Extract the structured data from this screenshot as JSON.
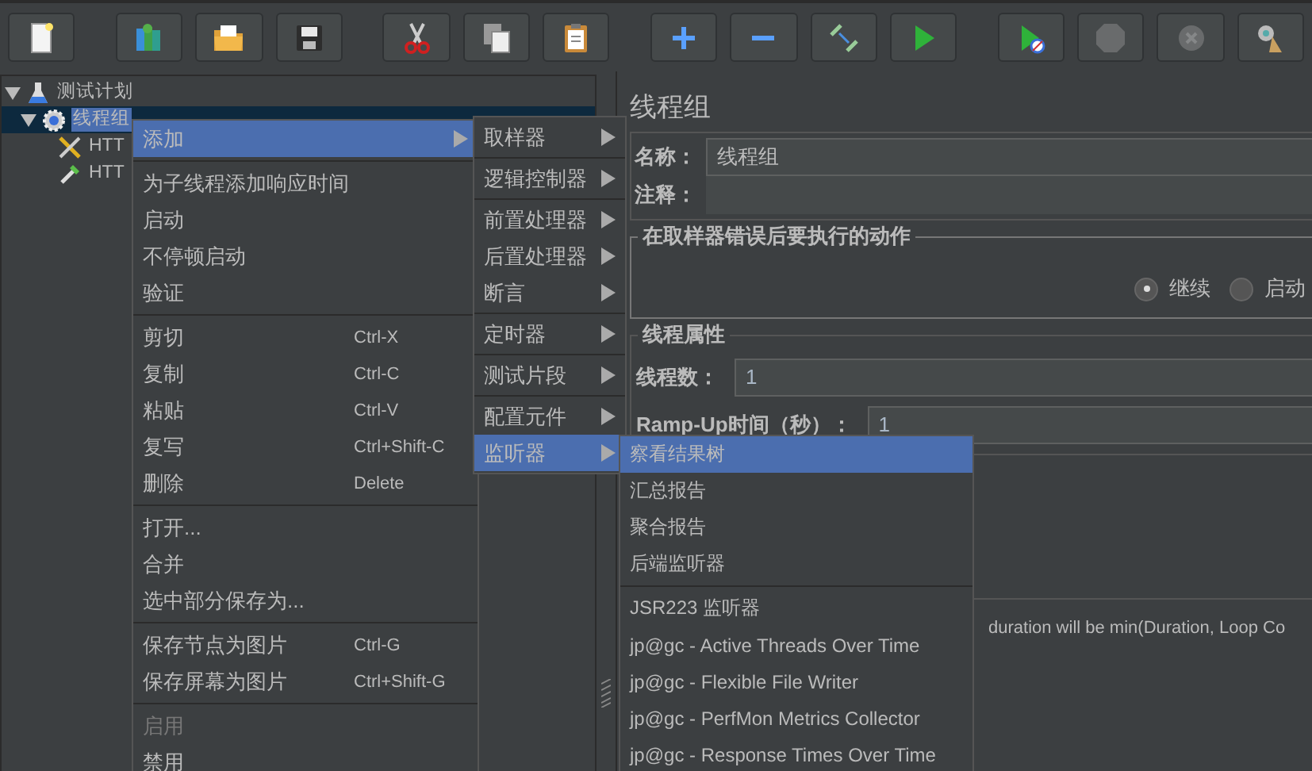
{
  "toolbar": [
    {
      "kind": "new",
      "disabled": false
    },
    {
      "kind": "templates",
      "disabled": false
    },
    {
      "kind": "open",
      "disabled": false
    },
    {
      "kind": "save",
      "disabled": false
    },
    {
      "kind": "cut",
      "disabled": false
    },
    {
      "kind": "copy",
      "disabled": false
    },
    {
      "kind": "paste",
      "disabled": false
    },
    {
      "kind": "expand",
      "disabled": false
    },
    {
      "kind": "collapse",
      "disabled": false
    },
    {
      "kind": "toggle",
      "disabled": false
    },
    {
      "kind": "start",
      "disabled": false
    },
    {
      "kind": "start-no-pause",
      "disabled": false
    },
    {
      "kind": "stop",
      "disabled": true
    },
    {
      "kind": "shutdown",
      "disabled": true
    },
    {
      "kind": "clear",
      "disabled": false
    }
  ],
  "tree": [
    {
      "label": "测试计划",
      "kind": "plan",
      "expanded": true,
      "selected": false,
      "children": [
        {
          "label": "线程组",
          "kind": "thread-group",
          "expanded": true,
          "selected": true,
          "children": [
            {
              "label": "HTT",
              "kind": "config",
              "selected": false
            },
            {
              "label": "HTT",
              "kind": "sampler",
              "selected": false
            }
          ]
        }
      ]
    }
  ],
  "menus": [
    {
      "groups": [
        [
          {
            "label": "添加",
            "submenu": true,
            "selected": true,
            "disabled": false
          }
        ],
        [
          {
            "label": "为子线程添加响应时间",
            "submenu": false,
            "selected": false,
            "disabled": false
          },
          {
            "label": "启动",
            "submenu": false,
            "selected": false,
            "disabled": false
          },
          {
            "label": "不停顿启动",
            "submenu": false,
            "selected": false,
            "disabled": false
          },
          {
            "label": "验证",
            "submenu": false,
            "selected": false,
            "disabled": false
          }
        ],
        [
          {
            "label": "剪切",
            "shortcut": "Ctrl-X",
            "submenu": false,
            "selected": false,
            "disabled": false
          },
          {
            "label": "复制",
            "shortcut": "Ctrl-C",
            "submenu": false,
            "selected": false,
            "disabled": false
          },
          {
            "label": "粘贴",
            "shortcut": "Ctrl-V",
            "submenu": false,
            "selected": false,
            "disabled": false
          },
          {
            "label": "复写",
            "shortcut": "Ctrl+Shift-C",
            "submenu": false,
            "selected": false,
            "disabled": false
          },
          {
            "label": "删除",
            "shortcut": "Delete",
            "submenu": false,
            "selected": false,
            "disabled": false
          }
        ],
        [
          {
            "label": "打开...",
            "submenu": false,
            "selected": false,
            "disabled": false
          },
          {
            "label": "合并",
            "submenu": false,
            "selected": false,
            "disabled": false
          },
          {
            "label": "选中部分保存为...",
            "submenu": false,
            "selected": false,
            "disabled": false
          }
        ],
        [
          {
            "label": "保存节点为图片",
            "shortcut": "Ctrl-G",
            "submenu": false,
            "selected": false,
            "disabled": false
          },
          {
            "label": "保存屏幕为图片",
            "shortcut": "Ctrl+Shift-G",
            "submenu": false,
            "selected": false,
            "disabled": false
          }
        ],
        [
          {
            "label": "启用",
            "submenu": false,
            "selected": false,
            "disabled": true
          },
          {
            "label": "禁用",
            "submenu": false,
            "selected": false,
            "disabled": false
          }
        ]
      ]
    },
    {
      "groups": [
        [
          {
            "label": "取样器",
            "submenu": true,
            "selected": false,
            "disabled": false
          }
        ],
        [
          {
            "label": "逻辑控制器",
            "submenu": true,
            "selected": false,
            "disabled": false
          }
        ],
        [
          {
            "label": "前置处理器",
            "submenu": true,
            "selected": false,
            "disabled": false
          },
          {
            "label": "后置处理器",
            "submenu": true,
            "selected": false,
            "disabled": false
          },
          {
            "label": "断言",
            "submenu": true,
            "selected": false,
            "disabled": false
          }
        ],
        [
          {
            "label": "定时器",
            "submenu": true,
            "selected": false,
            "disabled": false
          }
        ],
        [
          {
            "label": "测试片段",
            "submenu": true,
            "selected": false,
            "disabled": false
          }
        ],
        [
          {
            "label": "配置元件",
            "submenu": true,
            "selected": false,
            "disabled": false
          },
          {
            "label": "监听器",
            "submenu": true,
            "selected": true,
            "disabled": false
          }
        ]
      ]
    },
    {
      "groups": [
        [
          {
            "label": "察看结果树",
            "submenu": false,
            "selected": true,
            "disabled": false
          },
          {
            "label": "汇总报告",
            "submenu": false,
            "selected": false,
            "disabled": false
          },
          {
            "label": "聚合报告",
            "submenu": false,
            "selected": false,
            "disabled": false
          },
          {
            "label": "后端监听器",
            "submenu": false,
            "selected": false,
            "disabled": false
          }
        ],
        [
          {
            "label": "JSR223 监听器",
            "submenu": false,
            "selected": false,
            "disabled": false
          },
          {
            "label": "jp@gc - Active Threads Over Time",
            "submenu": false,
            "selected": false,
            "disabled": false
          },
          {
            "label": "jp@gc - Flexible File Writer",
            "submenu": false,
            "selected": false,
            "disabled": false
          },
          {
            "label": "jp@gc - PerfMon Metrics Collector",
            "submenu": false,
            "selected": false,
            "disabled": false
          },
          {
            "label": "jp@gc - Response Times Over Time",
            "submenu": false,
            "selected": false,
            "disabled": false
          }
        ]
      ]
    }
  ],
  "editor": {
    "title": "线程组",
    "name_label": "名称：",
    "name_value": "线程组",
    "comment_label": "注释：",
    "on_error": {
      "legend": "在取样器错误后要执行的动作",
      "options": [
        {
          "label": "继续",
          "selected": true
        },
        {
          "label": "启动",
          "selected": false
        }
      ]
    },
    "thread_props": {
      "legend": "线程属性",
      "fields": [
        {
          "label": "线程数：",
          "value": "1"
        },
        {
          "label": "Ramp-Up时间（秒）：",
          "value": "1"
        }
      ]
    },
    "note": "duration will be min(Duration, Loop Co"
  }
}
